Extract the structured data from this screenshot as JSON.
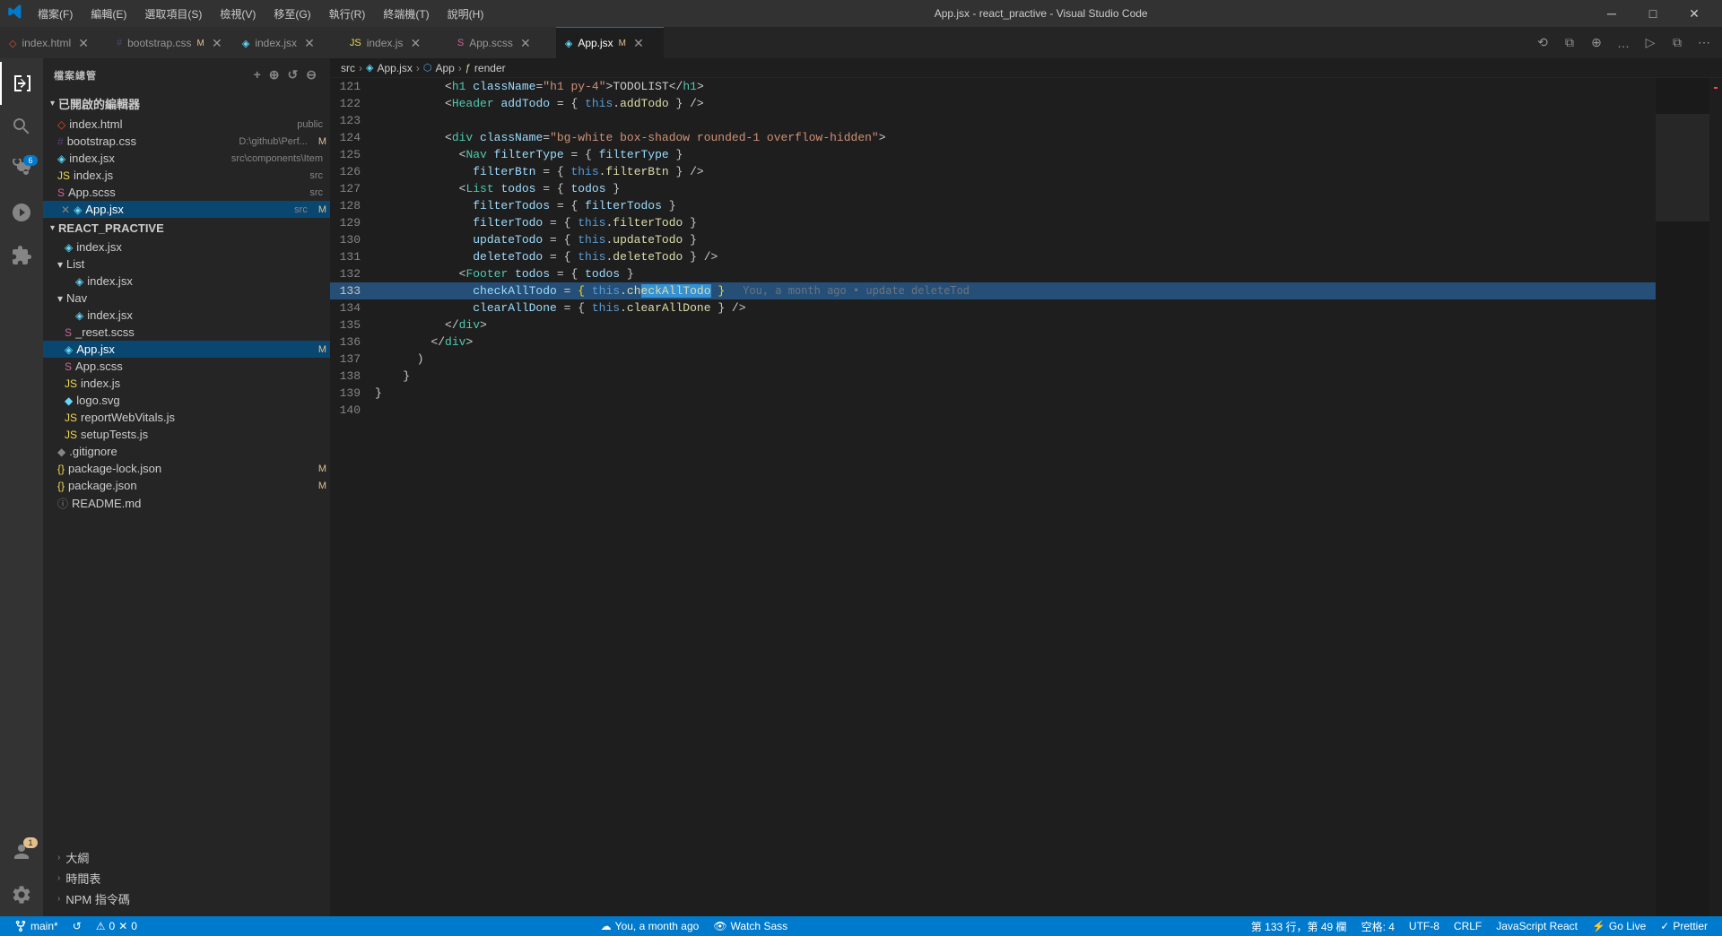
{
  "titleBar": {
    "logo": "VS",
    "menus": [
      "檔案(F)",
      "編輯(E)",
      "選取項目(S)",
      "檢視(V)",
      "移至(G)",
      "執行(R)",
      "終端機(T)",
      "說明(H)"
    ],
    "title": "App.jsx - react_practive - Visual Studio Code",
    "controls": [
      "─",
      "□",
      "✕"
    ]
  },
  "tabs": [
    {
      "id": "index-html",
      "icon": "◇",
      "iconClass": "html",
      "label": "index.html",
      "modified": false,
      "active": false
    },
    {
      "id": "bootstrap-css",
      "icon": "#",
      "iconClass": "css",
      "label": "bootstrap.css",
      "modified": true,
      "active": false
    },
    {
      "id": "index-jsx",
      "icon": "◈",
      "iconClass": "jsx",
      "label": "index.jsx",
      "modified": false,
      "active": false
    },
    {
      "id": "index-js",
      "icon": "JS",
      "iconClass": "js",
      "label": "index.js",
      "modified": false,
      "active": false
    },
    {
      "id": "app-scss",
      "icon": "S",
      "iconClass": "scss",
      "label": "App.scss",
      "modified": false,
      "active": false
    },
    {
      "id": "app-jsx",
      "icon": "◈",
      "iconClass": "jsx",
      "label": "App.jsx",
      "modified": true,
      "active": true
    }
  ],
  "breadcrumb": {
    "items": [
      "src",
      "App.jsx",
      "App",
      "render"
    ]
  },
  "sidebar": {
    "title": "檔案總管",
    "openEditors": {
      "label": "已開啟的編輯器",
      "files": [
        {
          "name": "index.html",
          "meta": "public",
          "icon": "◇",
          "modified": false,
          "hasClose": true
        },
        {
          "name": "bootstrap.css",
          "meta": "D:\\github\\Perf...",
          "icon": "#",
          "modified": true,
          "hasClose": true
        },
        {
          "name": "index.jsx",
          "meta": "src\\components\\Item",
          "icon": "◈",
          "modified": false,
          "hasClose": true
        },
        {
          "name": "index.js",
          "meta": "src",
          "icon": "JS",
          "modified": false,
          "hasClose": true
        },
        {
          "name": "App.scss",
          "meta": "src",
          "icon": "S",
          "modified": false,
          "hasClose": true
        },
        {
          "name": "App.jsx",
          "meta": "src",
          "icon": "◈",
          "modified": true,
          "active": true,
          "hasClose": true
        }
      ]
    },
    "projectName": "REACT_PRACTIVE",
    "files": [
      {
        "level": 1,
        "name": "index.jsx",
        "icon": "◈",
        "iconClass": "jsx"
      },
      {
        "level": 1,
        "name": "List",
        "icon": "▾",
        "isDir": true
      },
      {
        "level": 2,
        "name": "index.jsx",
        "icon": "◈",
        "iconClass": "jsx"
      },
      {
        "level": 1,
        "name": "Nav",
        "icon": "▾",
        "isDir": true
      },
      {
        "level": 2,
        "name": "index.jsx",
        "icon": "◈",
        "iconClass": "jsx"
      },
      {
        "level": 1,
        "name": "_reset.scss",
        "icon": "S",
        "iconClass": "scss"
      },
      {
        "level": 1,
        "name": "App.jsx",
        "icon": "◈",
        "iconClass": "jsx",
        "modified": true,
        "active": true
      },
      {
        "level": 1,
        "name": "App.scss",
        "icon": "S",
        "iconClass": "scss"
      },
      {
        "level": 1,
        "name": "index.js",
        "icon": "JS",
        "iconClass": "js"
      },
      {
        "level": 1,
        "name": "logo.svg",
        "icon": "◆",
        "iconClass": "svg"
      },
      {
        "level": 1,
        "name": "reportWebVitals.js",
        "icon": "JS",
        "iconClass": "js"
      },
      {
        "level": 1,
        "name": "setupTests.js",
        "icon": "JS",
        "iconClass": "js"
      },
      {
        "level": 0,
        "name": ".gitignore",
        "icon": "◆"
      },
      {
        "level": 0,
        "name": "package-lock.json",
        "icon": "{}",
        "modified": true
      },
      {
        "level": 0,
        "name": "package.json",
        "icon": "{}",
        "modified": true
      },
      {
        "level": 0,
        "name": "README.md",
        "icon": "ⓘ"
      }
    ],
    "bottomSections": [
      {
        "label": "大綱",
        "expanded": false
      },
      {
        "label": "時間表",
        "expanded": false
      },
      {
        "label": "NPM 指令碼",
        "expanded": false
      }
    ]
  },
  "codeLines": [
    {
      "num": 121,
      "tokens": [
        {
          "t": "          ",
          "c": "c-white"
        },
        {
          "t": "<",
          "c": "c-punct"
        },
        {
          "t": "h1",
          "c": "c-tag"
        },
        {
          "t": " ",
          "c": "c-white"
        },
        {
          "t": "className",
          "c": "c-attr"
        },
        {
          "t": "=\"h1 py-4\"",
          "c": "c-str"
        },
        {
          "t": ">TODOLIST</",
          "c": "c-white"
        },
        {
          "t": "h1",
          "c": "c-tag"
        },
        {
          "t": ">",
          "c": "c-punct"
        }
      ]
    },
    {
      "num": 122,
      "tokens": [
        {
          "t": "          ",
          "c": "c-white"
        },
        {
          "t": "<",
          "c": "c-punct"
        },
        {
          "t": "Header",
          "c": "c-jsx"
        },
        {
          "t": " ",
          "c": "c-white"
        },
        {
          "t": "addTodo",
          "c": "c-attr"
        },
        {
          "t": " = { ",
          "c": "c-white"
        },
        {
          "t": "this",
          "c": "c-this"
        },
        {
          "t": ".",
          "c": "c-white"
        },
        {
          "t": "addTodo",
          "c": "c-fn"
        },
        {
          "t": " } />",
          "c": "c-white"
        }
      ]
    },
    {
      "num": 123,
      "tokens": []
    },
    {
      "num": 124,
      "tokens": [
        {
          "t": "          ",
          "c": "c-white"
        },
        {
          "t": "<",
          "c": "c-punct"
        },
        {
          "t": "div",
          "c": "c-tag"
        },
        {
          "t": " ",
          "c": "c-white"
        },
        {
          "t": "className",
          "c": "c-attr"
        },
        {
          "t": "=\"bg-white box-shadow rounded-1 overflow-hidden\"",
          "c": "c-str"
        },
        {
          "t": ">",
          "c": "c-punct"
        }
      ]
    },
    {
      "num": 125,
      "tokens": [
        {
          "t": "            ",
          "c": "c-white"
        },
        {
          "t": "<",
          "c": "c-punct"
        },
        {
          "t": "Nav",
          "c": "c-jsx"
        },
        {
          "t": " ",
          "c": "c-white"
        },
        {
          "t": "filterType",
          "c": "c-attr"
        },
        {
          "t": " = { ",
          "c": "c-white"
        },
        {
          "t": "filterType",
          "c": "c-prop"
        },
        {
          "t": " }",
          "c": "c-white"
        }
      ]
    },
    {
      "num": 126,
      "tokens": [
        {
          "t": "              ",
          "c": "c-white"
        },
        {
          "t": "filterBtn",
          "c": "c-attr"
        },
        {
          "t": " = { ",
          "c": "c-white"
        },
        {
          "t": "this",
          "c": "c-this"
        },
        {
          "t": ".",
          "c": "c-white"
        },
        {
          "t": "filterBtn",
          "c": "c-fn"
        },
        {
          "t": " } />",
          "c": "c-white"
        }
      ]
    },
    {
      "num": 127,
      "tokens": [
        {
          "t": "            ",
          "c": "c-white"
        },
        {
          "t": "<",
          "c": "c-punct"
        },
        {
          "t": "List",
          "c": "c-jsx"
        },
        {
          "t": " ",
          "c": "c-white"
        },
        {
          "t": "todos",
          "c": "c-attr"
        },
        {
          "t": " = { ",
          "c": "c-white"
        },
        {
          "t": "todos",
          "c": "c-prop"
        },
        {
          "t": " }",
          "c": "c-white"
        }
      ]
    },
    {
      "num": 128,
      "tokens": [
        {
          "t": "              ",
          "c": "c-white"
        },
        {
          "t": "filterTodos",
          "c": "c-attr"
        },
        {
          "t": " = { ",
          "c": "c-white"
        },
        {
          "t": "filterTodos",
          "c": "c-prop"
        },
        {
          "t": " }",
          "c": "c-white"
        }
      ]
    },
    {
      "num": 129,
      "tokens": [
        {
          "t": "              ",
          "c": "c-white"
        },
        {
          "t": "filterTodo",
          "c": "c-attr"
        },
        {
          "t": " = { ",
          "c": "c-white"
        },
        {
          "t": "this",
          "c": "c-this"
        },
        {
          "t": ".",
          "c": "c-white"
        },
        {
          "t": "filterTodo",
          "c": "c-fn"
        },
        {
          "t": " }",
          "c": "c-white"
        }
      ]
    },
    {
      "num": 130,
      "tokens": [
        {
          "t": "              ",
          "c": "c-white"
        },
        {
          "t": "updateTodo",
          "c": "c-attr"
        },
        {
          "t": " = { ",
          "c": "c-white"
        },
        {
          "t": "this",
          "c": "c-this"
        },
        {
          "t": ".",
          "c": "c-white"
        },
        {
          "t": "updateTodo",
          "c": "c-fn"
        },
        {
          "t": " }",
          "c": "c-white"
        }
      ]
    },
    {
      "num": 131,
      "tokens": [
        {
          "t": "              ",
          "c": "c-white"
        },
        {
          "t": "deleteTodo",
          "c": "c-attr"
        },
        {
          "t": " = { ",
          "c": "c-white"
        },
        {
          "t": "this",
          "c": "c-this"
        },
        {
          "t": ".",
          "c": "c-white"
        },
        {
          "t": "deleteTodo",
          "c": "c-fn"
        },
        {
          "t": " } />",
          "c": "c-white"
        }
      ]
    },
    {
      "num": 132,
      "tokens": [
        {
          "t": "            ",
          "c": "c-white"
        },
        {
          "t": "<",
          "c": "c-punct"
        },
        {
          "t": "Footer",
          "c": "c-jsx"
        },
        {
          "t": " ",
          "c": "c-white"
        },
        {
          "t": "todos",
          "c": "c-attr"
        },
        {
          "t": " = { ",
          "c": "c-white"
        },
        {
          "t": "todos",
          "c": "c-prop"
        },
        {
          "t": " }",
          "c": "c-white"
        }
      ]
    },
    {
      "num": 133,
      "tokens": [
        {
          "t": "              ",
          "c": "c-white"
        },
        {
          "t": "checkAllTodo",
          "c": "c-attr"
        },
        {
          "t": " = ",
          "c": "c-white"
        },
        {
          "t": "{",
          "c": "c-brace"
        },
        {
          "t": " ",
          "c": "c-white"
        },
        {
          "t": "this",
          "c": "c-this"
        },
        {
          "t": ".",
          "c": "c-white"
        },
        {
          "t": "checkAllTodo",
          "c": "c-fn"
        },
        {
          "t": " ",
          "c": "c-white"
        },
        {
          "t": "}",
          "c": "c-brace"
        }
      ],
      "blame": "You, a month ago • update deleteTod",
      "cursor": true
    },
    {
      "num": 134,
      "tokens": [
        {
          "t": "              ",
          "c": "c-white"
        },
        {
          "t": "clearAllDone",
          "c": "c-attr"
        },
        {
          "t": " = { ",
          "c": "c-white"
        },
        {
          "t": "this",
          "c": "c-this"
        },
        {
          "t": ".",
          "c": "c-white"
        },
        {
          "t": "clearAllDone",
          "c": "c-fn"
        },
        {
          "t": " } />",
          "c": "c-white"
        }
      ]
    },
    {
      "num": 135,
      "tokens": [
        {
          "t": "          ",
          "c": "c-white"
        },
        {
          "t": "</",
          "c": "c-punct"
        },
        {
          "t": "div",
          "c": "c-tag"
        },
        {
          "t": ">",
          "c": "c-punct"
        }
      ]
    },
    {
      "num": 136,
      "tokens": [
        {
          "t": "        ",
          "c": "c-white"
        },
        {
          "t": "</",
          "c": "c-punct"
        },
        {
          "t": "div",
          "c": "c-tag"
        },
        {
          "t": ">",
          "c": "c-punct"
        }
      ]
    },
    {
      "num": 137,
      "tokens": [
        {
          "t": "      )",
          "c": "c-white"
        }
      ]
    },
    {
      "num": 138,
      "tokens": [
        {
          "t": "    }",
          "c": "c-white"
        }
      ]
    },
    {
      "num": 139,
      "tokens": [
        {
          "t": "}",
          "c": "c-white"
        }
      ]
    },
    {
      "num": 140,
      "tokens": []
    }
  ],
  "statusBar": {
    "left": [
      {
        "icon": "⎇",
        "label": "main*"
      },
      {
        "icon": "↺",
        "label": ""
      },
      {
        "icon": "⚠",
        "label": "0"
      },
      {
        "icon": "✕",
        "label": "0"
      }
    ],
    "center": [
      {
        "icon": "☁",
        "label": "You, a month ago"
      },
      {
        "icon": "👁",
        "label": "Watch Sass"
      }
    ],
    "right": [
      {
        "label": "第 133 行，第 49 欄"
      },
      {
        "label": "空格: 4"
      },
      {
        "label": "UTF-8"
      },
      {
        "label": "CRLF"
      },
      {
        "label": "JavaScript React"
      },
      {
        "label": "Go Live"
      },
      {
        "label": "✓ Prettier"
      }
    ]
  }
}
